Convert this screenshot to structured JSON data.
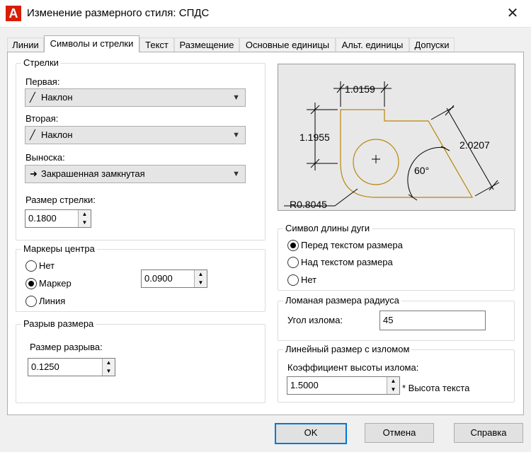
{
  "window": {
    "icon_letter": "A",
    "title": "Изменение размерного стиля: СПДС",
    "close_glyph": "✕"
  },
  "tabs": [
    "Линии",
    "Символы и стрелки",
    "Текст",
    "Размещение",
    "Основные единицы",
    "Альт. единицы",
    "Допуски"
  ],
  "active_tab": 1,
  "arrows": {
    "title": "Стрелки",
    "first_label": "Первая:",
    "first_value": "Наклон",
    "second_label": "Вторая:",
    "second_value": "Наклон",
    "leader_label": "Выноска:",
    "leader_value": "Закрашенная замкнутая",
    "size_label": "Размер стрелки:",
    "size_value": "0.1800"
  },
  "center_marks": {
    "title": "Маркеры центра",
    "option_none": "Нет",
    "option_mark": "Маркер",
    "option_line": "Линия",
    "selected": "Маркер",
    "size_value": "0.0900"
  },
  "dim_break": {
    "title": "Разрыв размера",
    "size_label": "Размер разрыва:",
    "size_value": "0.1250"
  },
  "preview": {
    "dim_top": "1.0159",
    "dim_left": "1.1955",
    "dim_diag": "2.0207",
    "dim_angle": "60°",
    "dim_radius": "R0.8045"
  },
  "arc_length": {
    "title": "Символ длины дуги",
    "option_before": "Перед текстом размера",
    "option_above": "Над текстом размера",
    "option_none": "Нет",
    "selected": "Перед текстом размера"
  },
  "radius_jog": {
    "title": "Ломаная размера радиуса",
    "angle_label": "Угол излома:",
    "angle_value": "45"
  },
  "linear_jog": {
    "title": "Линейный размер с изломом",
    "factor_label": "Коэффициент высоты излома:",
    "factor_value": "1.5000",
    "suffix": "* Высота текста"
  },
  "buttons": {
    "ok": "OK",
    "cancel": "Отмена",
    "help": "Справка"
  },
  "colors": {
    "accent": "#0078d7",
    "brand": "#d81e05",
    "preview_outline": "#b8860b"
  }
}
